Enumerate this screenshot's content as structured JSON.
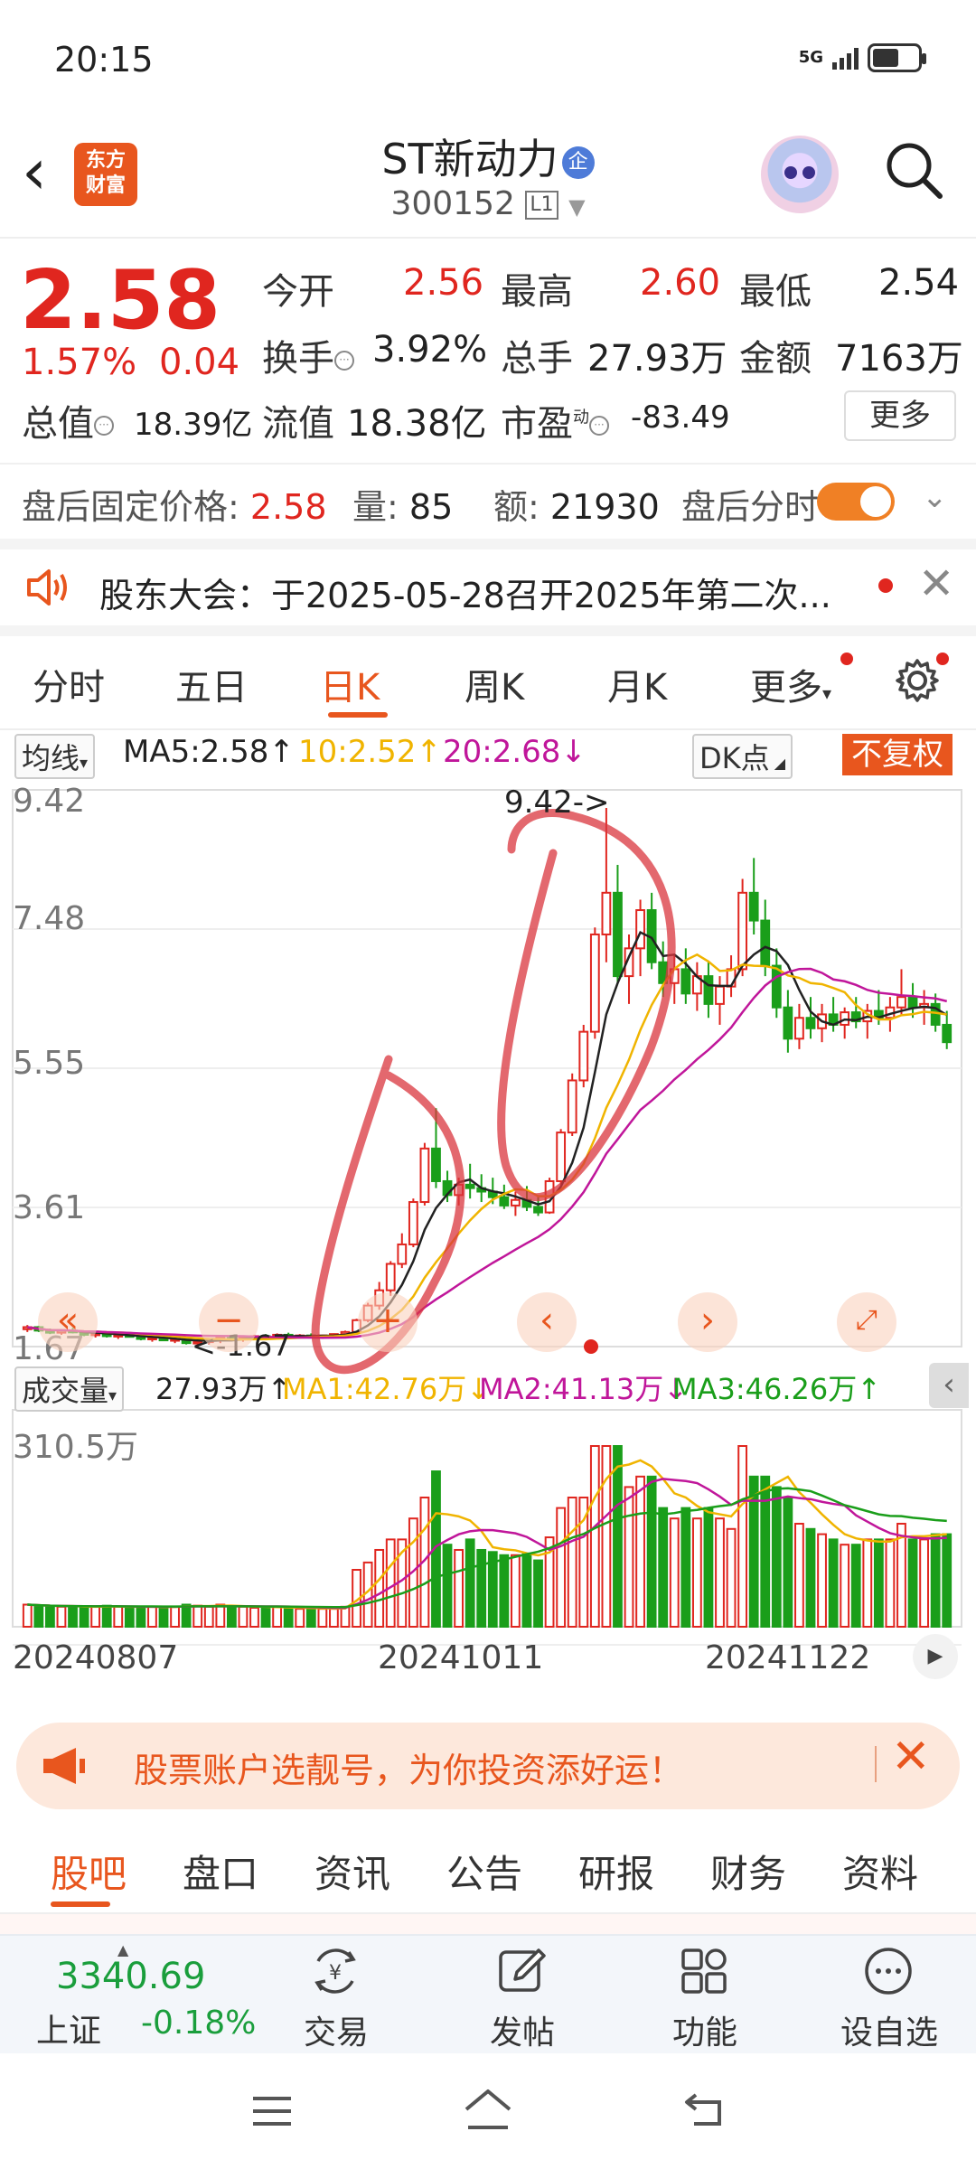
{
  "status_bar": {
    "time": "20:15",
    "network": "5G"
  },
  "header": {
    "logo_line1": "东方",
    "logo_line2": "财富",
    "stock_name": "ST新动力",
    "stock_tag": "企",
    "stock_code": "300152",
    "level_badge": "L1"
  },
  "quote": {
    "price": "2.58",
    "change_pct": "1.57%",
    "change_amt": "0.04",
    "open_label": "今开",
    "open": "2.56",
    "high_label": "最高",
    "high": "2.60",
    "low_label": "最低",
    "low": "2.54",
    "turnover_label": "换手",
    "turnover": "3.92%",
    "volume_label": "总手",
    "volume": "27.93万",
    "amount_label": "金额",
    "amount": "7163万",
    "mktcap_label": "总值",
    "mktcap": "18.39亿",
    "float_label": "流值",
    "float": "18.38亿",
    "pe_label": "市盈",
    "pe_sup": "动",
    "pe": "-83.49",
    "more_button": "更多"
  },
  "after_hours": {
    "fixed_price_label": "盘后固定价格:",
    "fixed_price": "2.58",
    "volume_label": "量:",
    "volume": "85",
    "amount_label": "额:",
    "amount": "21930",
    "timeshare_label": "盘后分时"
  },
  "notice": {
    "text": "股东大会：于2025-05-28召开2025年第二次..."
  },
  "chart_tabs": [
    "分时",
    "五日",
    "日K",
    "周K",
    "月K",
    "更多"
  ],
  "active_chart_tab": "日K",
  "ma_row": {
    "selector": "均线",
    "ma5": "MA5:2.58",
    "ma10": "10:2.52",
    "ma20": "20:2.68",
    "dk_button": "DK点",
    "fq_button": "不复权"
  },
  "kline_axis": {
    "y_ticks": [
      "9.42",
      "7.48",
      "5.55",
      "3.61",
      "1.67"
    ],
    "high_marker": "9.42->",
    "low_marker": "<-1.67"
  },
  "volume_row": {
    "selector": "成交量",
    "vol": "27.93万",
    "ma1": "MA1:42.76万",
    "ma2": "MA2:41.13万",
    "ma3": "MA3:46.26万",
    "y_max": "310.5万"
  },
  "date_axis": [
    "20240807",
    "20241011",
    "20241122"
  ],
  "colors": {
    "up": "#e0261f",
    "down": "#1a9e1a",
    "accent": "#e8561e",
    "ma5": "#222222",
    "ma10": "#f0b400",
    "ma20": "#c0169a"
  },
  "promo": {
    "text": "股票账户选靓号，为你投资添好运！"
  },
  "bottom_tabs": [
    "股吧",
    "盘口",
    "资讯",
    "公告",
    "研报",
    "财务",
    "资料"
  ],
  "dock": {
    "index_value": "3340.69",
    "index_name": "上证",
    "index_change": "-0.18%",
    "items": [
      "交易",
      "发帖",
      "功能",
      "设自选"
    ]
  },
  "chart_data": {
    "type": "candlestick",
    "y_range": [
      1.67,
      9.42
    ],
    "series": [
      {
        "name": "candles",
        "ohlc": [
          [
            1.92,
            1.98,
            1.88,
            1.95
          ],
          [
            1.95,
            1.97,
            1.88,
            1.9
          ],
          [
            1.9,
            1.93,
            1.85,
            1.87
          ],
          [
            1.87,
            1.92,
            1.84,
            1.9
          ],
          [
            1.9,
            1.94,
            1.86,
            1.88
          ],
          [
            1.88,
            1.9,
            1.82,
            1.84
          ],
          [
            1.84,
            1.88,
            1.8,
            1.86
          ],
          [
            1.86,
            1.89,
            1.8,
            1.82
          ],
          [
            1.82,
            1.86,
            1.78,
            1.84
          ],
          [
            1.84,
            1.87,
            1.8,
            1.81
          ],
          [
            1.81,
            1.84,
            1.76,
            1.78
          ],
          [
            1.78,
            1.82,
            1.74,
            1.8
          ],
          [
            1.8,
            1.83,
            1.75,
            1.76
          ],
          [
            1.76,
            1.8,
            1.72,
            1.78
          ],
          [
            1.78,
            1.8,
            1.7,
            1.72
          ],
          [
            1.72,
            1.76,
            1.67,
            1.74
          ],
          [
            1.74,
            1.78,
            1.7,
            1.76
          ],
          [
            1.76,
            1.82,
            1.72,
            1.8
          ],
          [
            1.8,
            1.84,
            1.76,
            1.78
          ],
          [
            1.78,
            1.82,
            1.74,
            1.8
          ],
          [
            1.8,
            1.84,
            1.77,
            1.82
          ],
          [
            1.82,
            1.85,
            1.78,
            1.8
          ],
          [
            1.8,
            1.86,
            1.78,
            1.84
          ],
          [
            1.84,
            1.87,
            1.8,
            1.82
          ],
          [
            1.82,
            1.85,
            1.79,
            1.83
          ],
          [
            1.83,
            1.86,
            1.8,
            1.81
          ],
          [
            1.81,
            1.84,
            1.78,
            1.83
          ],
          [
            1.83,
            1.86,
            1.8,
            1.85
          ],
          [
            1.85,
            1.9,
            1.82,
            1.88
          ],
          [
            1.88,
            2.07,
            1.86,
            2.05
          ],
          [
            2.05,
            2.3,
            2.02,
            2.26
          ],
          [
            2.26,
            2.6,
            2.2,
            2.48
          ],
          [
            2.48,
            2.9,
            2.4,
            2.86
          ],
          [
            2.86,
            3.3,
            2.8,
            3.14
          ],
          [
            3.14,
            3.8,
            3.1,
            3.75
          ],
          [
            3.75,
            4.6,
            3.7,
            4.52
          ],
          [
            4.52,
            5.1,
            3.95,
            4.05
          ],
          [
            4.05,
            4.2,
            3.75,
            3.85
          ],
          [
            3.85,
            4.1,
            3.7,
            4.0
          ],
          [
            4.0,
            4.3,
            3.8,
            3.95
          ],
          [
            3.95,
            4.15,
            3.75,
            3.9
          ],
          [
            3.9,
            4.1,
            3.72,
            3.82
          ],
          [
            3.82,
            4.0,
            3.65,
            3.7
          ],
          [
            3.7,
            3.9,
            3.55,
            3.78
          ],
          [
            3.78,
            3.98,
            3.62,
            3.68
          ],
          [
            3.68,
            3.85,
            3.55,
            3.6
          ],
          [
            3.6,
            4.1,
            3.58,
            4.05
          ],
          [
            4.05,
            4.8,
            4.0,
            4.75
          ],
          [
            4.75,
            5.6,
            4.7,
            5.5
          ],
          [
            5.5,
            6.3,
            5.4,
            6.2
          ],
          [
            6.2,
            7.7,
            6.1,
            7.6
          ],
          [
            7.6,
            9.42,
            7.2,
            8.2
          ],
          [
            8.2,
            8.6,
            6.9,
            7.0
          ],
          [
            7.0,
            7.6,
            6.6,
            7.4
          ],
          [
            7.4,
            8.1,
            7.0,
            7.95
          ],
          [
            7.95,
            8.2,
            7.1,
            7.2
          ],
          [
            7.2,
            7.5,
            6.7,
            6.9
          ],
          [
            6.9,
            7.3,
            6.6,
            7.1
          ],
          [
            7.1,
            7.4,
            6.6,
            6.75
          ],
          [
            6.75,
            7.2,
            6.5,
            7.0
          ],
          [
            7.0,
            7.2,
            6.4,
            6.6
          ],
          [
            6.6,
            7.0,
            6.3,
            6.85
          ],
          [
            6.85,
            7.3,
            6.7,
            7.1
          ],
          [
            7.1,
            8.4,
            7.0,
            8.2
          ],
          [
            8.2,
            8.7,
            7.6,
            7.8
          ],
          [
            7.8,
            8.1,
            7.0,
            7.15
          ],
          [
            7.15,
            7.4,
            6.4,
            6.55
          ],
          [
            6.55,
            6.8,
            5.9,
            6.1
          ],
          [
            6.1,
            6.6,
            5.95,
            6.4
          ],
          [
            6.4,
            6.7,
            6.1,
            6.25
          ],
          [
            6.25,
            6.6,
            6.05,
            6.45
          ],
          [
            6.45,
            6.7,
            6.2,
            6.3
          ],
          [
            6.3,
            6.55,
            6.1,
            6.48
          ],
          [
            6.48,
            6.7,
            6.25,
            6.35
          ],
          [
            6.35,
            6.6,
            6.1,
            6.5
          ],
          [
            6.5,
            6.8,
            6.3,
            6.4
          ],
          [
            6.4,
            6.7,
            6.2,
            6.55
          ],
          [
            6.55,
            7.1,
            6.45,
            6.7
          ],
          [
            6.7,
            6.9,
            6.4,
            6.55
          ],
          [
            6.55,
            6.8,
            6.3,
            6.6
          ],
          [
            6.6,
            6.75,
            6.2,
            6.3
          ],
          [
            6.3,
            6.5,
            5.95,
            6.05
          ]
        ]
      }
    ],
    "volume_max": 310.5
  }
}
